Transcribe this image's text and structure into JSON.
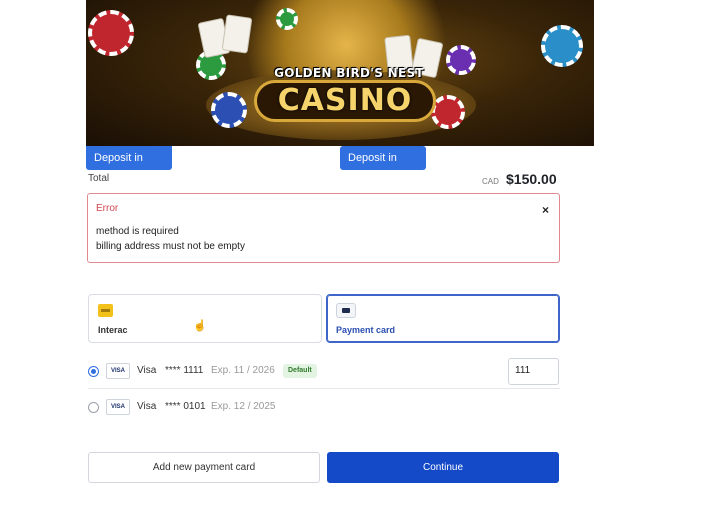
{
  "banner": {
    "logo_top": "GOLDEN BIRD'S NEST",
    "logo_main": "CASINO"
  },
  "deposit": {
    "usd_label": "Deposit in USD",
    "cad_label": "Deposit in CAD"
  },
  "total": {
    "label": "Total",
    "currency": "CAD",
    "amount": "$150.00"
  },
  "error": {
    "title": "Error",
    "close": "×",
    "messages": [
      "method is required",
      "billing address must not be empty"
    ]
  },
  "methods": [
    {
      "label": "Interac",
      "icon": "interac-icon",
      "selected": false
    },
    {
      "label": "Payment card",
      "icon": "credit-card-icon",
      "selected": true
    }
  ],
  "saved_cards": [
    {
      "badge": "VISA",
      "brand": "Visa",
      "last4": "**** 1111",
      "expiry": "Exp. 11 / 2026",
      "default_label": "Default",
      "selected": true,
      "cvv": "111"
    },
    {
      "badge": "VISA",
      "brand": "Visa",
      "last4": "**** 0101",
      "expiry": "Exp. 12 / 2025",
      "selected": false
    }
  ],
  "actions": {
    "add_card": "Add new payment card",
    "continue": "Continue"
  },
  "colors": {
    "primary": "#1449c8",
    "deposit_button": "#2f6fe0",
    "error_border": "#e0898f",
    "error_title": "#d0464f"
  }
}
